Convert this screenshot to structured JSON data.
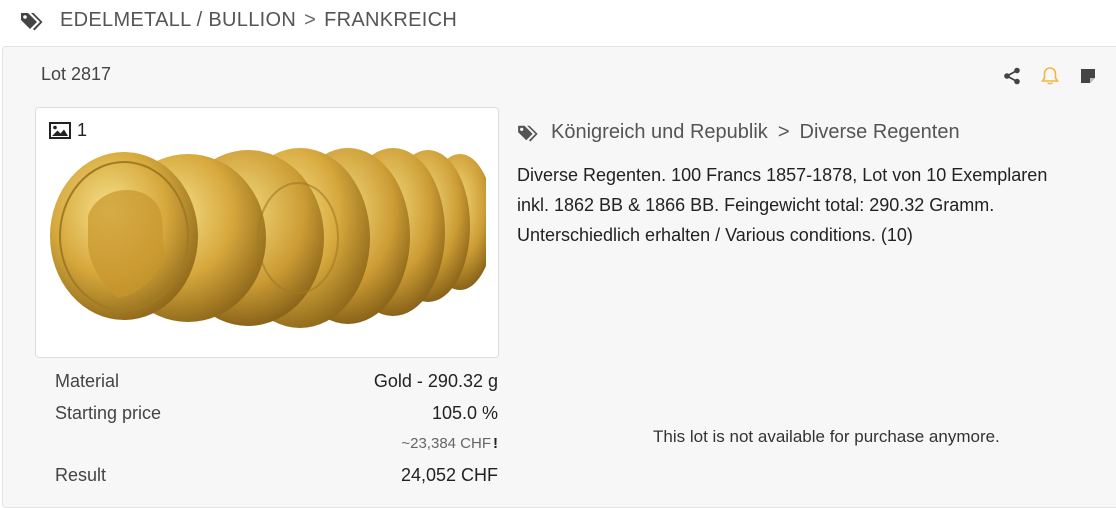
{
  "breadcrumb": {
    "items": [
      "EDELMETALL / BULLION",
      "FRANKREICH"
    ],
    "separator": ">"
  },
  "lot": {
    "title": "Lot 2817",
    "image_count": "1",
    "category": {
      "parent": "Königreich und Republik",
      "child": "Diverse Regenten",
      "separator": ">"
    },
    "description": [
      "Diverse Regenten. 100 Francs 1857-1878, Lot von 10 Exemplaren",
      "inkl. 1862 BB & 1866 BB. Feingewicht total: 290.32 Gramm.",
      "Unterschiedlich erhalten / Various conditions. (10)"
    ],
    "details": {
      "material_label": "Material",
      "material_value": "Gold - 290.32 g",
      "starting_label": "Starting price",
      "starting_value": "105.0 %",
      "starting_approx": "~23,384 CHF",
      "starting_approx_mark": "!",
      "result_label": "Result",
      "result_value": "24,052 CHF"
    },
    "notice": "This lot is not available for purchase anymore."
  },
  "icons": {
    "share": "share-icon",
    "bell": "bell-icon",
    "note": "note-icon",
    "tag": "tag-icon",
    "image": "image-icon"
  },
  "colors": {
    "bell_accent": "#f0b840",
    "card_bg": "#f7f7f7"
  }
}
